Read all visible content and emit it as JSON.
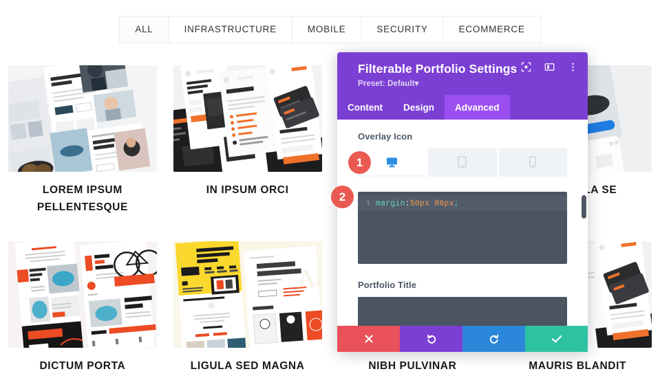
{
  "filter_bar": {
    "items": [
      {
        "label": "ALL",
        "active": true
      },
      {
        "label": "INFRASTRUCTURE",
        "active": false
      },
      {
        "label": "MOBILE",
        "active": false
      },
      {
        "label": "SECURITY",
        "active": false
      },
      {
        "label": "ECOMMERCE",
        "active": false
      }
    ]
  },
  "portfolio": {
    "rows": [
      [
        {
          "title": "LOREM IPSUM PELLENTESQUE",
          "thumb": "sunglasses-shop-mockup"
        },
        {
          "title": "IN IPSUM ORCI",
          "thumb": "dark-orange-mobile-app-mockup"
        },
        {
          "title": "",
          "thumb": "hidden-behind-panel"
        },
        {
          "title": "ES LIGULA SE",
          "thumb": "ecommerce-phone-mockup"
        }
      ],
      [
        {
          "title": "DICTUM PORTA",
          "thumb": "bike-repair-mockup"
        },
        {
          "title": "LIGULA SED MAGNA",
          "thumb": "yellow-business-mockup"
        },
        {
          "title": "NIBH PULVINAR",
          "thumb": "hidden-behind-panel"
        },
        {
          "title": "MAURIS BLANDIT",
          "thumb": "dark-orange-mobile-app-mockup"
        }
      ]
    ]
  },
  "settings_panel": {
    "title": "Filterable Portfolio Settings",
    "preset": "Preset: Default",
    "preset_caret": "▾",
    "header_icons": [
      {
        "name": "focus-icon"
      },
      {
        "name": "layout-panel-icon"
      },
      {
        "name": "kebab-menu-icon"
      }
    ],
    "tabs": [
      {
        "label": "Content",
        "active": false
      },
      {
        "label": "Design",
        "active": false
      },
      {
        "label": "Advanced",
        "active": true
      }
    ],
    "overlay_icon": {
      "label": "Overlay Icon",
      "devices": [
        {
          "name": "desktop",
          "active": true
        },
        {
          "name": "tablet",
          "active": false
        },
        {
          "name": "phone",
          "active": false
        }
      ]
    },
    "code_editor": {
      "line_number": "1",
      "property": "margin",
      "colon": ":",
      "value": "50px 86px",
      "semicolon": ";"
    },
    "portfolio_title": {
      "label": "Portfolio Title",
      "value": ""
    },
    "footer_buttons": [
      {
        "name": "close",
        "icon": "x-icon"
      },
      {
        "name": "undo",
        "icon": "undo-arrow-icon"
      },
      {
        "name": "redo",
        "icon": "redo-arrow-icon"
      },
      {
        "name": "save",
        "icon": "check-icon"
      }
    ]
  },
  "callouts": [
    {
      "id": "1",
      "label": "1"
    },
    {
      "id": "2",
      "label": "2"
    }
  ],
  "colors": {
    "purple": "#7b3fd4",
    "purple_active": "#9b4ff0",
    "red": "#e9515b",
    "blue": "#2b87da",
    "teal": "#2ec2a3",
    "badge_red": "#ea5a52",
    "code_bg": "#4b5562",
    "code_prop": "#5fd3bc",
    "code_value": "#f2994a",
    "device_active_blue": "#2d8fe0"
  }
}
